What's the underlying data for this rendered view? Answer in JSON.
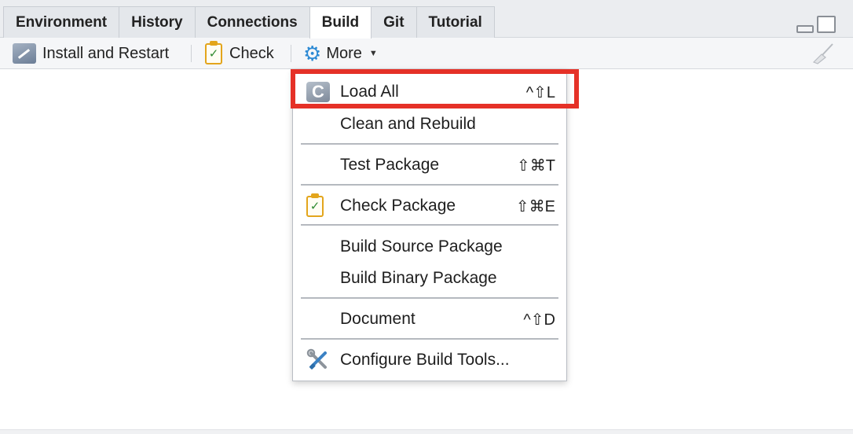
{
  "tabs": [
    {
      "label": "Environment",
      "active": false
    },
    {
      "label": "History",
      "active": false
    },
    {
      "label": "Connections",
      "active": false
    },
    {
      "label": "Build",
      "active": true
    },
    {
      "label": "Git",
      "active": false
    },
    {
      "label": "Tutorial",
      "active": false
    }
  ],
  "toolbar": {
    "install_label": "Install and Restart",
    "check_label": "Check",
    "more_label": "More"
  },
  "menu": {
    "items": [
      {
        "label": "Load All",
        "shortcut": "^⇧L",
        "icon": "load-all-icon"
      },
      {
        "label": "Clean and Rebuild",
        "shortcut": ""
      },
      {
        "label": "Test Package",
        "shortcut": "⇧⌘T"
      },
      {
        "label": "Check Package",
        "shortcut": "⇧⌘E",
        "icon": "check-package-icon"
      },
      {
        "label": "Build Source Package",
        "shortcut": ""
      },
      {
        "label": "Build Binary Package",
        "shortcut": ""
      },
      {
        "label": "Document",
        "shortcut": "^⇧D"
      },
      {
        "label": "Configure Build Tools...",
        "shortcut": "",
        "icon": "tools-icon"
      }
    ]
  },
  "highlight": {
    "target": "Load All",
    "color": "#e53127"
  },
  "colors": {
    "accent": "#2d8ad4",
    "check_orange": "#e3a51c",
    "check_green": "#2f8a2f"
  }
}
